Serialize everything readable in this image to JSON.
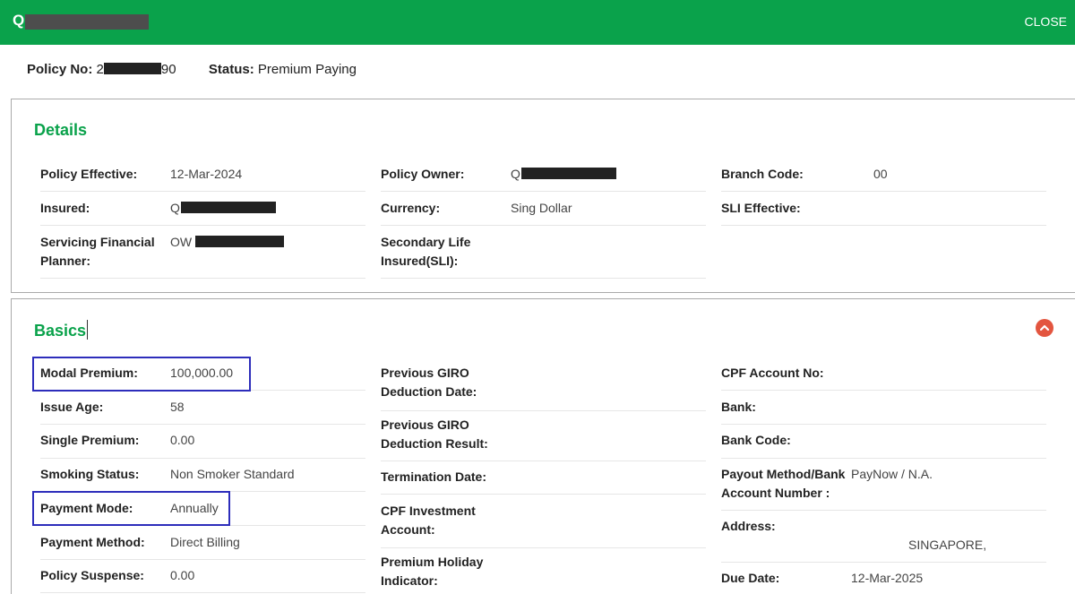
{
  "header": {
    "title_initial": "Q",
    "close_label": "CLOSE"
  },
  "policy": {
    "policy_no_label": "Policy No:",
    "policy_no_prefix": "2",
    "policy_no_suffix": "90",
    "status_label": "Status:",
    "status_value": "Premium Paying"
  },
  "details": {
    "title": "Details",
    "policy_effective": {
      "label": "Policy Effective:",
      "value": "12-Mar-2024"
    },
    "insured": {
      "label": "Insured:",
      "value": "Q"
    },
    "planner": {
      "label_1": "Servicing Financial",
      "label_2": "Planner:",
      "value": "OW"
    },
    "policy_owner": {
      "label": "Policy Owner:",
      "value": "Q"
    },
    "currency": {
      "label": "Currency:",
      "value": "Sing Dollar"
    },
    "sli": {
      "label_1": "Secondary Life",
      "label_2": "Insured(SLI):"
    },
    "branch_code": {
      "label": "Branch Code:",
      "value": "00"
    },
    "sli_effective": {
      "label": "SLI Effective:"
    }
  },
  "basics": {
    "title": "Basics",
    "modal_premium": {
      "label": "Modal Premium:",
      "value": "100,000.00"
    },
    "issue_age": {
      "label": "Issue Age:",
      "value": "58"
    },
    "single_premium": {
      "label": "Single Premium:",
      "value": "0.00"
    },
    "smoking_status": {
      "label": "Smoking Status:",
      "value": "Non Smoker Standard"
    },
    "payment_mode": {
      "label": "Payment Mode:",
      "value": "Annually"
    },
    "payment_method": {
      "label": "Payment Method:",
      "value": "Direct Billing"
    },
    "policy_suspense": {
      "label": "Policy Suspense:",
      "value": "0.00"
    },
    "prev_giro_date": {
      "label_1": "Previous GIRO",
      "label_2": "Deduction Date:"
    },
    "prev_giro_result": {
      "label_1": "Previous GIRO",
      "label_2": "Deduction Result:"
    },
    "termination_date": {
      "label": "Termination Date:"
    },
    "cpf_investment": {
      "label_1": "CPF Investment",
      "label_2": "Account:"
    },
    "premium_holiday": {
      "label_1": "Premium Holiday",
      "label_2": "Indicator:"
    },
    "cpf_account_no": {
      "label": "CPF Account No:"
    },
    "bank": {
      "label": "Bank:"
    },
    "bank_code": {
      "label": "Bank Code:"
    },
    "payout": {
      "label_1": "Payout Method/Bank",
      "label_2": "Account Number :",
      "value": "PayNow / N.A."
    },
    "address": {
      "label": "Address:",
      "value": "SINGAPORE,"
    },
    "due_date": {
      "label": "Due Date:",
      "value": "12-Mar-2025"
    }
  },
  "colors": {
    "brand_green": "#0aa24b",
    "highlight_blue": "#2d2dbb",
    "collapse_red": "#e3553f"
  }
}
